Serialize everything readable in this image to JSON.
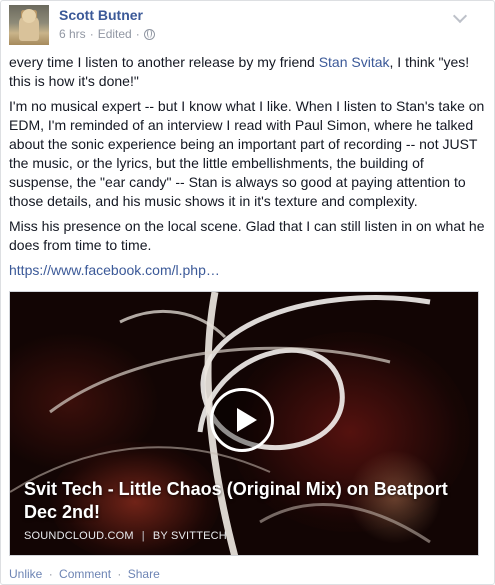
{
  "post": {
    "author": "Scott Butner",
    "time": "6 hrs",
    "edited": "Edited",
    "privacy_icon": "globe-icon",
    "paragraph1_before": "every time I listen to another release by my friend ",
    "paragraph1_mention": "Stan Svitak",
    "paragraph1_after": ", I think \"yes! this is how it's done!\"",
    "paragraph2": "I'm no musical expert -- but I know what I like. When I listen to Stan's take on EDM, I'm reminded of an interview I read with Paul Simon, where he talked about the sonic experience being an important part of recording -- not JUST the music, or the lyrics, but the little embellishments, the building of suspense, the \"ear candy\" -- Stan is always so good at paying attention to those details, and his music shows it in it's texture and complexity.",
    "paragraph3": "Miss his presence on the local scene. Glad that I can still listen in on what he does from time to time.",
    "url": "https://www.facebook.com/l.php…"
  },
  "share": {
    "title": "Svit Tech - Little Chaos (Original Mix) on Beatport Dec 2nd!",
    "source": "SOUNDCLOUD.COM",
    "separator": "|",
    "byline": "BY SVITTECH"
  },
  "actions": {
    "unlike": "Unlike",
    "comment": "Comment",
    "share": "Share",
    "dot": "·"
  }
}
